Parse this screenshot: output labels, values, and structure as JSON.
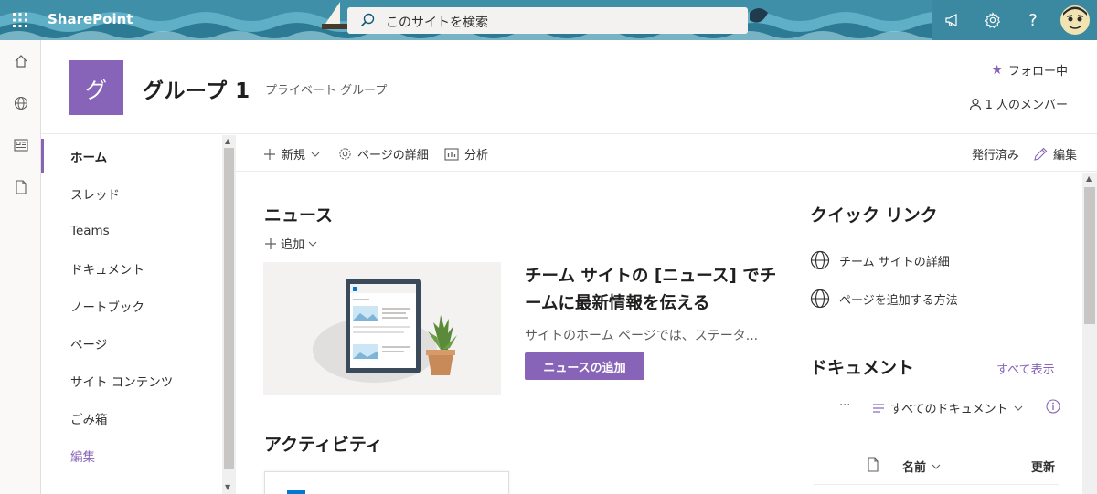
{
  "suitebar": {
    "brand": "SharePoint",
    "search_placeholder": "このサイトを検索",
    "icons": [
      "waffle-icon",
      "megaphone-icon",
      "gear-icon",
      "help-icon",
      "user-avatar"
    ],
    "help_label": "?",
    "bg_color": "#3f8fa8"
  },
  "rail": {
    "icons": [
      "home-icon",
      "globe-icon",
      "news-icon",
      "page-icon"
    ]
  },
  "site": {
    "logo_letter": "グ",
    "logo_color": "#8764b8",
    "title": "グループ 1",
    "type": "プライベート グループ",
    "follow_label": "フォロー中",
    "members_label": "1 人のメンバー"
  },
  "nav": {
    "items": [
      {
        "label": "ホーム",
        "active": true
      },
      {
        "label": "スレッド"
      },
      {
        "label": "Teams"
      },
      {
        "label": "ドキュメント"
      },
      {
        "label": "ノートブック"
      },
      {
        "label": "ページ"
      },
      {
        "label": "サイト コンテンツ"
      },
      {
        "label": "ごみ箱"
      },
      {
        "label": "編集"
      }
    ]
  },
  "commandbar": {
    "new_label": "新規",
    "page_details_label": "ページの詳細",
    "analytics_label": "分析",
    "published_label": "発行済み",
    "edit_label": "編集"
  },
  "news": {
    "title": "ニュース",
    "add_label": "追加",
    "headline": "チーム サイトの [ニュース] でチームに最新情報を伝える",
    "description": "サイトのホーム ページでは、ステータ...",
    "button_label": "ニュースの追加"
  },
  "activity": {
    "title": "アクティビティ"
  },
  "quicklinks": {
    "title": "クイック リンク",
    "items": [
      "チーム サイトの詳細",
      "ページを追加する方法"
    ]
  },
  "documents": {
    "title": "ドキュメント",
    "see_all": "すべて表示",
    "more": "···",
    "view_label": "すべてのドキュメント",
    "col_name": "名前",
    "col_modified": "更新"
  },
  "colors": {
    "accent": "#8764b8",
    "text": "#323130"
  }
}
